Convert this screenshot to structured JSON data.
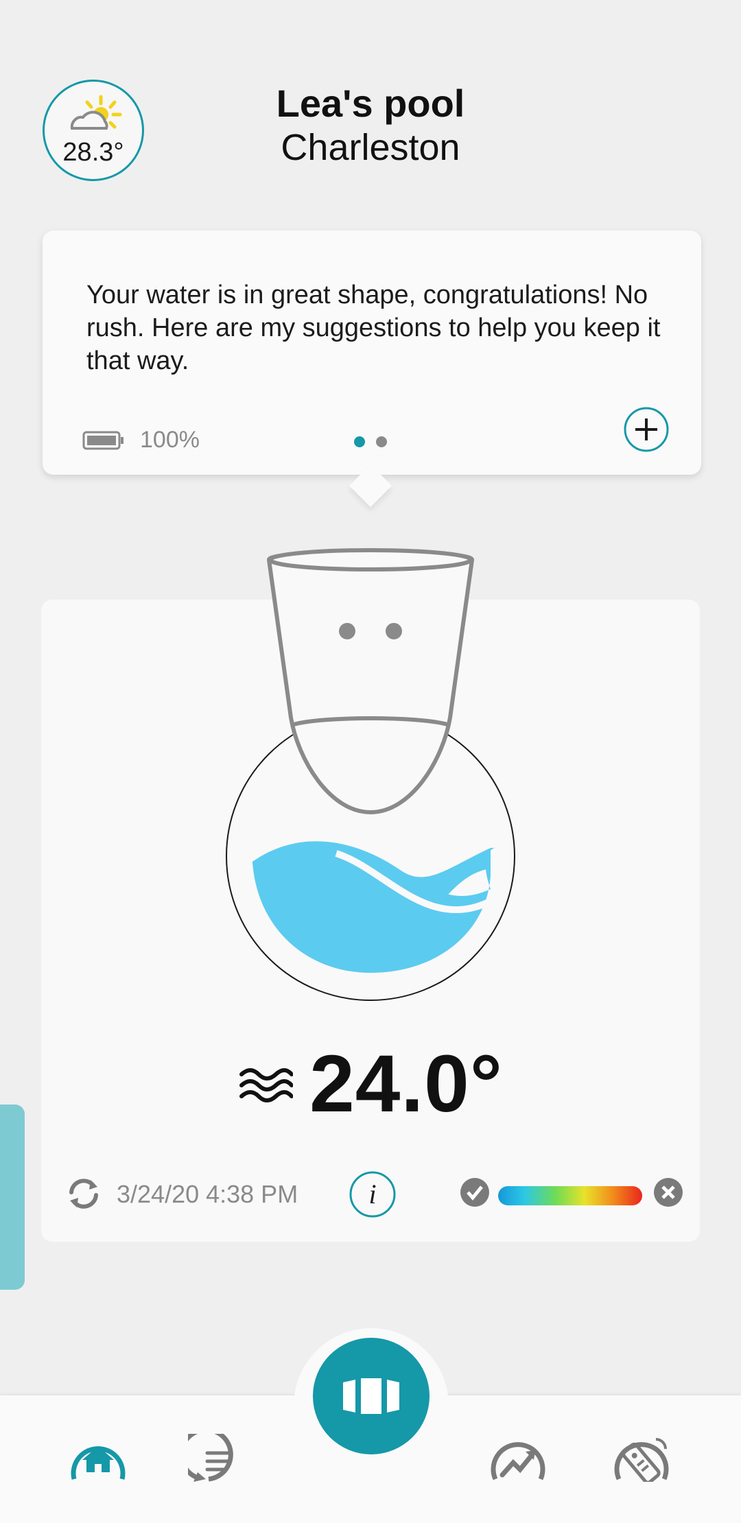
{
  "header": {
    "weather_temp": "28.3°",
    "pool_name": "Lea's pool",
    "location": "Charleston"
  },
  "message_card": {
    "text": "Your water is in great shape, congratulations! No rush. Here are my suggestions to help you keep it that way.",
    "battery_percent": "100%",
    "battery_level": 1.0,
    "page_count": 2,
    "active_page": 1
  },
  "main_card": {
    "water_temperature": "24.0°",
    "last_sync": "3/24/20 4:38 PM"
  },
  "colors": {
    "accent": "#1598a8",
    "water": "#5ccbf0",
    "background": "#efefef",
    "card": "#fafafa"
  },
  "icons": [
    "sun-cloud-icon",
    "battery-icon",
    "plus-icon",
    "waves-icon",
    "sync-icon",
    "info-icon",
    "check-icon",
    "close-icon",
    "home-icon",
    "messages-icon",
    "stats-icon",
    "remote-icon",
    "device-icon"
  ],
  "bottom_nav": {
    "items": [
      "home",
      "messages",
      "device",
      "stats",
      "remote"
    ],
    "active": "home"
  }
}
